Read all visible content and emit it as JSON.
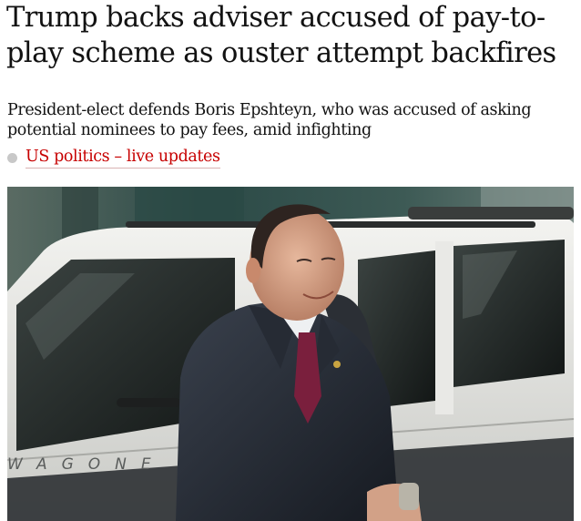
{
  "article": {
    "headline": "Trump backs adviser accused of pay-to-play scheme as ouster attempt backfires",
    "standfirst": "President-elect defends Boris Epshteyn, who was accused of asking potential nominees to pay fees, amid infighting",
    "live_link": {
      "label": "US politics – live updates",
      "color": "#c70000"
    },
    "photo": {
      "vehicle_badge_text": "WAGONE"
    }
  }
}
